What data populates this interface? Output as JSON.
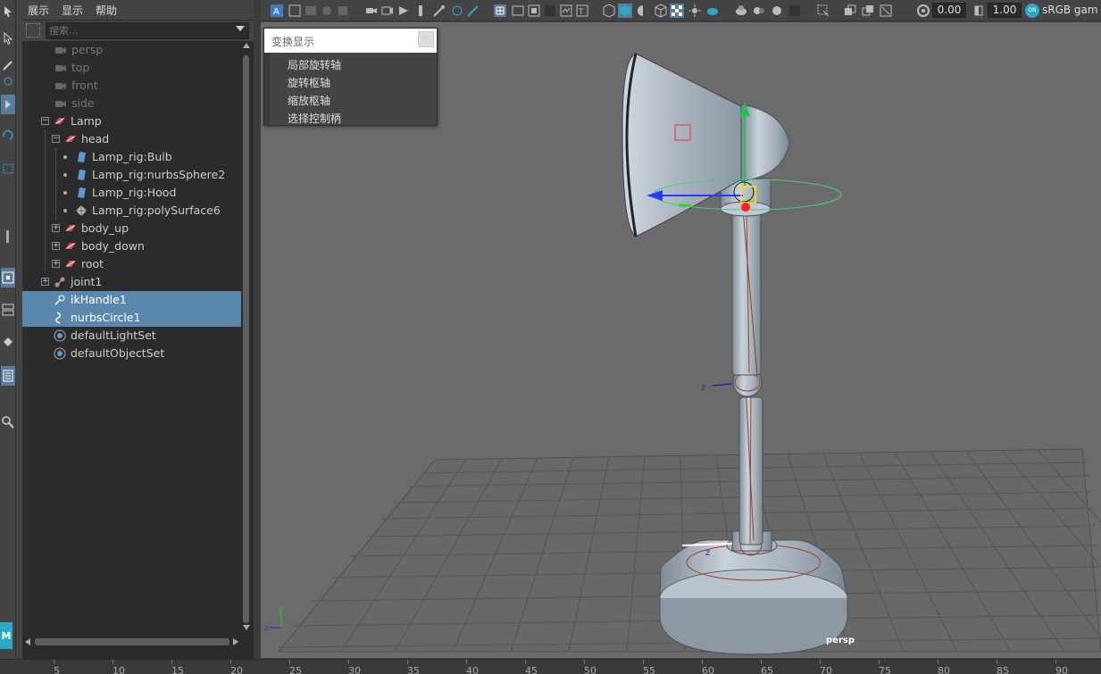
{
  "outliner": {
    "menu": [
      "展示",
      "显示",
      "帮助"
    ],
    "search_placeholder": "搜索...",
    "items": [
      {
        "label": "persp"
      },
      {
        "label": "top"
      },
      {
        "label": "front"
      },
      {
        "label": "side"
      },
      {
        "label": "Lamp"
      },
      {
        "label": "head"
      },
      {
        "label": "Lamp_rig:Bulb"
      },
      {
        "label": "Lamp_rig:nurbsSphere2"
      },
      {
        "label": "Lamp_rig:Hood"
      },
      {
        "label": "Lamp_rig:polySurface6"
      },
      {
        "label": "body_up"
      },
      {
        "label": "body_down"
      },
      {
        "label": "root"
      },
      {
        "label": "joint1"
      },
      {
        "label": "ikHandle1"
      },
      {
        "label": "nurbsCircle1"
      },
      {
        "label": "defaultLightSet"
      },
      {
        "label": "defaultObjectSet"
      }
    ]
  },
  "viewport_toolbar": {
    "value_a": "0.00",
    "value_b": "1.00",
    "colorspace_badge": "ON",
    "colorspace": "sRGB gam"
  },
  "popup": {
    "title": "变换显示",
    "items": [
      "局部旋转轴",
      "旋转枢轴",
      "缩放枢轴",
      "选择控制柄"
    ]
  },
  "viewport": {
    "camera_label": "persp",
    "axis_label": "z"
  },
  "timeline": {
    "ticks": [
      "5",
      "10",
      "15",
      "20",
      "25",
      "30",
      "35",
      "40",
      "45",
      "50",
      "55",
      "60",
      "65",
      "70",
      "75",
      "80",
      "85",
      "90"
    ]
  },
  "colors": {
    "selection": "#5a88ad",
    "outliner_bg": "#2b2b2b",
    "viewport_bg": "#6b6b6b",
    "accent_blue": "#2aa8c8"
  }
}
